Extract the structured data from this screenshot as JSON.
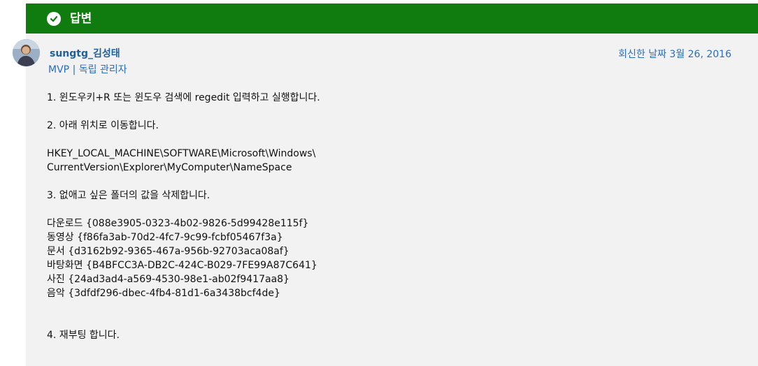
{
  "header": {
    "title": "답변",
    "status_icon": "check-circle-icon",
    "accent_color": "#107c10"
  },
  "author": {
    "name": "sungtg_김성태",
    "badge": "MVP",
    "separator": "|",
    "role": "독립 관리자",
    "avatar": "user-avatar"
  },
  "reply_date": "회신한 날짜 3월 26, 2016",
  "content": {
    "step1": "1. 윈도우키+R 또는 윈도우 검색에 regedit 입력하고 실행합니다.",
    "step2": "2. 아래 위치로 이동합니다.",
    "path_line1": "HKEY_LOCAL_MACHINE\\SOFTWARE\\Microsoft\\Windows\\",
    "path_line2": "CurrentVersion\\Explorer\\MyComputer\\NameSpace",
    "step3": "3. 없애고 싶은 폴더의 값을 삭제합니다.",
    "folders": [
      "다운로드 {088e3905-0323-4b02-9826-5d99428e115f}",
      "동영상 {f86fa3ab-70d2-4fc7-9c99-fcbf05467f3a}",
      "문서 {d3162b92-9365-467a-956b-92703aca08af}",
      "바탕화면 {B4BFCC3A-DB2C-424C-B029-7FE99A87C641}",
      "사진 {24ad3ad4-a569-4530-98e1-ab02f9417aa8}",
      "음악 {3dfdf296-dbec-4fb4-81d1-6a3438bcf4de}"
    ],
    "step4": "4. 재부팅 합니다."
  }
}
